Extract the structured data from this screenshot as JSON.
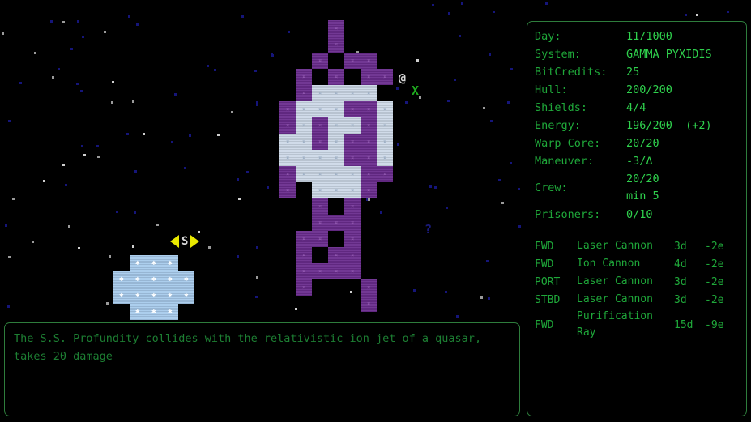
{
  "status_panel": {
    "rows": [
      {
        "label": "Day:",
        "value": "11/1000"
      },
      {
        "label": "System:",
        "value": "GAMMA PYXIDIS"
      },
      {
        "label": "BitCredits:",
        "value": "25"
      },
      {
        "label": "Hull:",
        "value": "200/200"
      },
      {
        "label": "Shields:",
        "value": "4/4"
      },
      {
        "label": "Energy:",
        "value": "196/200  (+2)"
      },
      {
        "label": "Warp Core:",
        "value": "20/20"
      },
      {
        "label": "Maneuver:",
        "value": "-3/Δ"
      },
      {
        "label": "Crew:",
        "value": "20/20",
        "value2": "min 5"
      },
      {
        "label": "Prisoners:",
        "value": "0/10"
      }
    ]
  },
  "weapons": {
    "items": [
      {
        "arc": "FWD",
        "name": "Laser Cannon",
        "damage": "3d",
        "cost": "-2e"
      },
      {
        "arc": "FWD",
        "name": "Ion Cannon",
        "damage": "4d",
        "cost": "-2e"
      },
      {
        "arc": "PORT",
        "name": "Laser Cannon",
        "damage": "3d",
        "cost": "-2e"
      },
      {
        "arc": "STBD",
        "name": "Laser Cannon",
        "damage": "3d",
        "cost": "-2e"
      },
      {
        "arc": "FWD",
        "name": "Purification\nRay",
        "damage": "15d",
        "cost": "-9e"
      }
    ]
  },
  "message_log": {
    "text": "The S.S. Profundity collides with the relativistic ion jet of a quasar, takes 20 damage"
  },
  "map": {
    "player_marker": "@",
    "target_marker": "X",
    "unknown_marker": "?",
    "selection_letter": "S",
    "enemy_tile_glyph": "¤",
    "ally_tile_glyph": "✱"
  },
  "colors": {
    "panel_border": "#2e7d3c",
    "label_green": "#1fa83a",
    "value_green": "#2fd14d",
    "log_green": "#1d7f33",
    "hull_purple": "#6b2d8e",
    "hull_pale": "#cdd9e8",
    "ally_blue": "#a8cbec",
    "cursor_yellow": "#e8e800",
    "target_green": "#1faa1f",
    "player_white": "#d8d8d8"
  }
}
